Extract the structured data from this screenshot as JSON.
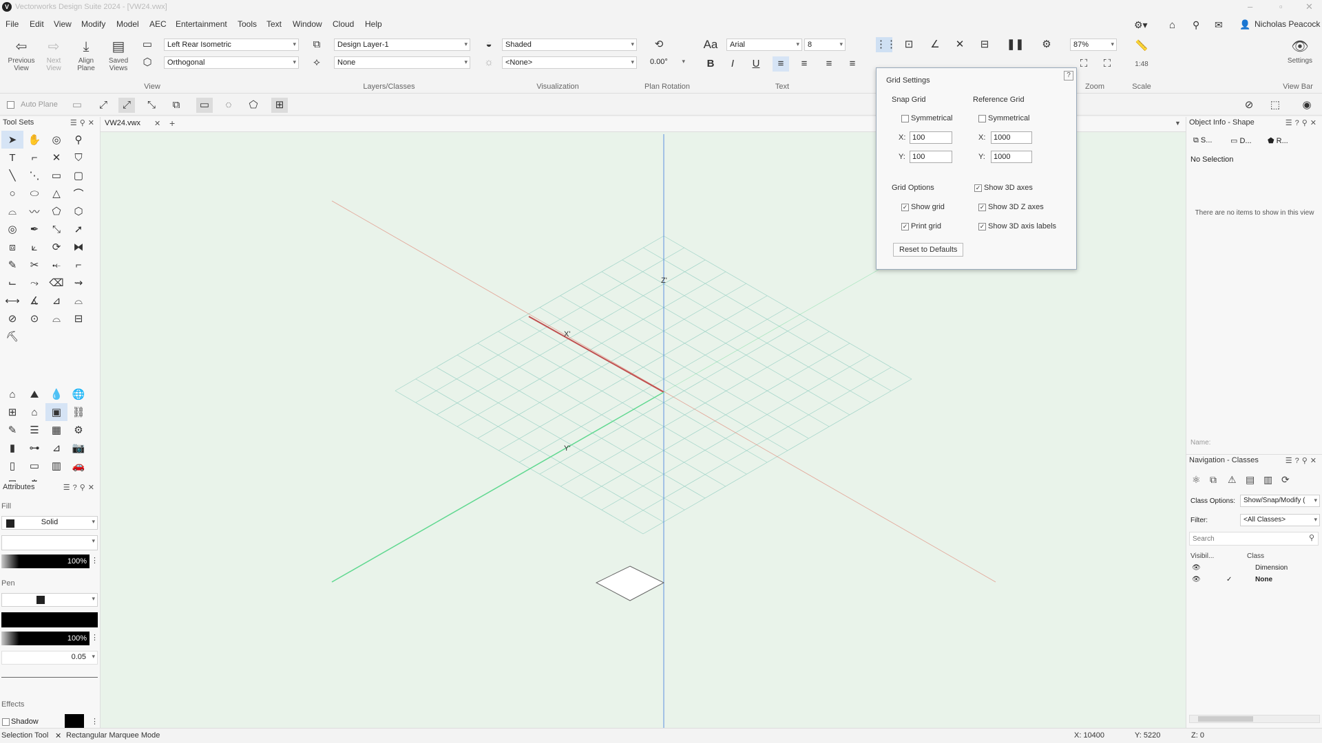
{
  "app": {
    "title": "Vectorworks Design Suite 2024 - [VW24.vwx]",
    "user": "Nicholas Peacock"
  },
  "menu": [
    "File",
    "Edit",
    "View",
    "Modify",
    "Model",
    "AEC",
    "Entertainment",
    "Tools",
    "Text",
    "Window",
    "Cloud",
    "Help"
  ],
  "ribbon": {
    "previous_view": "Previous View",
    "next_view": "Next View",
    "align_plane": "Align Plane",
    "saved_views": "Saved Views",
    "view_dropdown": "Left Rear Isometric",
    "projection_dropdown": "Orthogonal",
    "group_view": "View",
    "layer_dropdown": "Design Layer-1",
    "class_dropdown": "None",
    "group_layers": "Layers/Classes",
    "render_dropdown": "Shaded",
    "lighting_dropdown": "<None>",
    "group_visualization": "Visualization",
    "plan_rotation_value": "0.00°",
    "group_plan_rotation": "Plan Rotation",
    "font_dropdown": "Arial",
    "font_size": "8",
    "group_text": "Text",
    "suspend": "Suspend",
    "settings_snap": "Settings",
    "zoom_value": "87%",
    "group_zoom": "Zoom",
    "scale_value": "1:48",
    "group_scale": "Scale",
    "settings_viewbar": "Settings",
    "group_viewbar": "View Bar"
  },
  "row2": {
    "auto_plane": "Auto Plane"
  },
  "toolsets": {
    "title": "Tool Sets"
  },
  "document_tab": "VW24.vwx",
  "attributes": {
    "title": "Attributes",
    "fill_label": "Fill",
    "fill_style": "Solid",
    "fill_opacity": "100%",
    "pen_label": "Pen",
    "pen_opacity": "100%",
    "line_weight": "0.05",
    "effects_label": "Effects",
    "shadow_label": "Shadow"
  },
  "canvas": {
    "axis_z": "Z'",
    "axis_x": "X'",
    "axis_y": "Y'"
  },
  "grid_settings": {
    "title": "Grid Settings",
    "snap_grid": "Snap Grid",
    "reference_grid": "Reference Grid",
    "symmetrical": "Symmetrical",
    "snap_x": "100",
    "snap_y": "100",
    "ref_x": "1000",
    "ref_y": "1000",
    "x_label": "X:",
    "y_label": "Y:",
    "grid_options": "Grid Options",
    "show_grid": "Show grid",
    "print_grid": "Print grid",
    "show_3d_axes": "Show 3D axes",
    "show_3d_z_axes": "Show 3D Z axes",
    "show_3d_axis_labels": "Show 3D axis labels",
    "reset": "Reset to Defaults",
    "help": "?"
  },
  "object_info": {
    "title": "Object Info - Shape",
    "tab1": "S...",
    "tab2": "D...",
    "tab3": "R...",
    "selection": "No Selection",
    "empty_msg": "There are no items to show in this view",
    "name_label": "Name:"
  },
  "navigation": {
    "title": "Navigation - Classes",
    "class_options_label": "Class Options:",
    "class_options_value": "Show/Snap/Modify (",
    "filter_label": "Filter:",
    "filter_value": "<All Classes>",
    "search_placeholder": "Search",
    "col_visibility": "Visibil...",
    "col_class": "Class",
    "rows": [
      {
        "name": "Dimension",
        "active": ""
      },
      {
        "name": "None",
        "active": "✓"
      }
    ]
  },
  "status": {
    "tool": "Selection Tool",
    "mode": "Rectangular Marquee Mode",
    "x": "X: 10400",
    "y": "Y: 5220",
    "z": "Z: 0"
  },
  "colors": {
    "canvas": "#e9f3ea",
    "x_axis": "#e08070",
    "y_axis": "#60d890",
    "z_axis": "#5a8fe0"
  }
}
